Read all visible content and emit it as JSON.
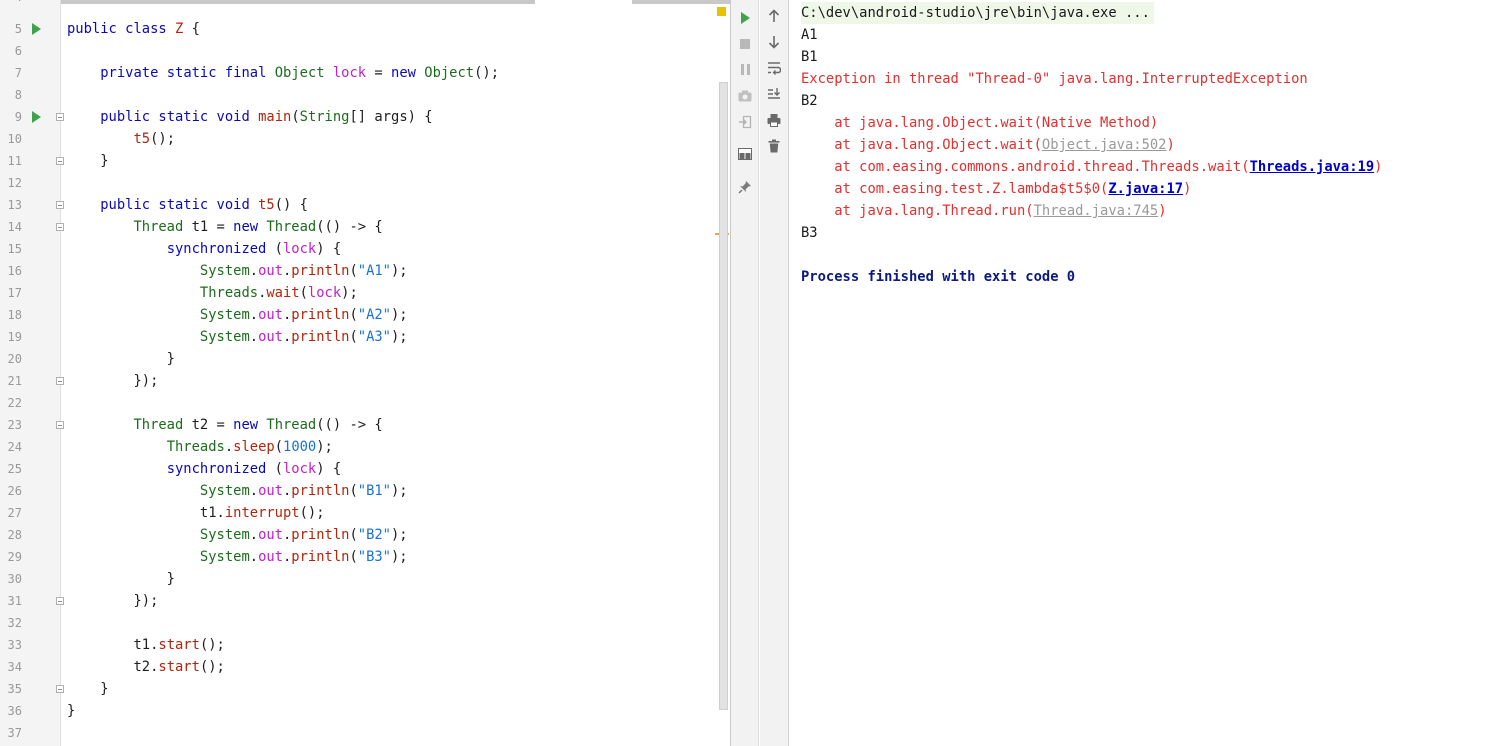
{
  "editor": {
    "top_line_number": "4",
    "lines": [
      {
        "n": "5",
        "text": "public class Z {",
        "run": true
      },
      {
        "n": "6",
        "text": ""
      },
      {
        "n": "7",
        "text": "    private static final Object lock = new Object();"
      },
      {
        "n": "8",
        "text": ""
      },
      {
        "n": "9",
        "text": "    public static void main(String[] args) {",
        "run": true,
        "fold": true
      },
      {
        "n": "10",
        "text": "        t5();"
      },
      {
        "n": "11",
        "text": "    }",
        "fold": true
      },
      {
        "n": "12",
        "text": ""
      },
      {
        "n": "13",
        "text": "    public static void t5() {",
        "fold": true
      },
      {
        "n": "14",
        "text": "        Thread t1 = new Thread(() -> {",
        "fold": true
      },
      {
        "n": "15",
        "text": "            synchronized (lock) {"
      },
      {
        "n": "16",
        "text": "                System.out.println(\"A1\");"
      },
      {
        "n": "17",
        "text": "                Threads.wait(lock);"
      },
      {
        "n": "18",
        "text": "                System.out.println(\"A2\");"
      },
      {
        "n": "19",
        "text": "                System.out.println(\"A3\");"
      },
      {
        "n": "20",
        "text": "            }"
      },
      {
        "n": "21",
        "text": "        });",
        "fold": true
      },
      {
        "n": "22",
        "text": ""
      },
      {
        "n": "23",
        "text": "        Thread t2 = new Thread(() -> {",
        "fold": true
      },
      {
        "n": "24",
        "text": "            Threads.sleep(1000);"
      },
      {
        "n": "25",
        "text": "            synchronized (lock) {"
      },
      {
        "n": "26",
        "text": "                System.out.println(\"B1\");"
      },
      {
        "n": "27",
        "text": "                t1.interrupt();"
      },
      {
        "n": "28",
        "text": "                System.out.println(\"B2\");"
      },
      {
        "n": "29",
        "text": "                System.out.println(\"B3\");"
      },
      {
        "n": "30",
        "text": "            }"
      },
      {
        "n": "31",
        "text": "        });",
        "fold": true
      },
      {
        "n": "32",
        "text": ""
      },
      {
        "n": "33",
        "text": "        t1.start();"
      },
      {
        "n": "34",
        "text": "        t2.start();"
      },
      {
        "n": "35",
        "text": "    }",
        "fold": true
      },
      {
        "n": "36",
        "text": "}"
      },
      {
        "n": "37",
        "text": ""
      }
    ]
  },
  "run_toolbar": {
    "left": [
      "rerun-icon",
      "stop-icon",
      "pause-icon",
      "camera-icon",
      "login-icon",
      "layout-icon",
      "pin-icon"
    ],
    "right": [
      "arrow-up-icon",
      "arrow-down-icon",
      "soft-wrap-icon",
      "scroll-to-end-icon",
      "print-icon",
      "trash-icon"
    ]
  },
  "console": {
    "command": "C:\\dev\\android-studio\\jre\\bin\\java.exe ...",
    "out_a1": "A1",
    "out_b1": "B1",
    "exception": "Exception in thread \"Thread-0\" java.lang.InterruptedException",
    "out_b2": "B2",
    "stack": [
      {
        "prefix": "    at java.lang.Object.wait(Native Method)",
        "link": "",
        "suffix": ""
      },
      {
        "prefix": "    at java.lang.Object.wait(",
        "link": "Object.java:502",
        "suffix": ")",
        "link_style": "gray"
      },
      {
        "prefix": "    at com.easing.commons.android.thread.Threads.wait(",
        "link": "Threads.java:19",
        "suffix": ")",
        "link_style": "blue"
      },
      {
        "prefix": "    at com.easing.test.Z.lambda$t5$0(",
        "link": "Z.java:17",
        "suffix": ")",
        "link_style": "blue"
      },
      {
        "prefix": "    at java.lang.Thread.run(",
        "link": "Thread.java:745",
        "suffix": ")",
        "link_style": "gray"
      }
    ],
    "out_b3": "B3",
    "finished": "Process finished with exit code 0"
  },
  "colors": {
    "keyword": "#0a0ab4",
    "error": "#e03030",
    "run_green": "#3ea34a",
    "link_blue": "#0000cc",
    "finished": "#0a1a80"
  }
}
